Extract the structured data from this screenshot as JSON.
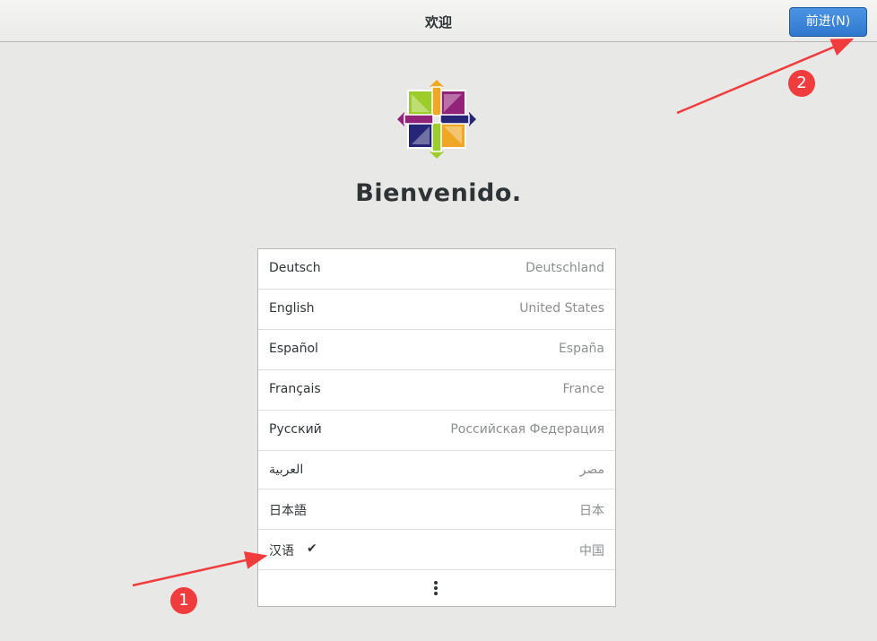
{
  "header": {
    "title": "欢迎",
    "next_label": "前进(N)"
  },
  "welcome_text": "Bienvenido.",
  "languages": [
    {
      "name": "Deutsch",
      "region": "Deutschland"
    },
    {
      "name": "English",
      "region": "United States"
    },
    {
      "name": "Español",
      "region": "España"
    },
    {
      "name": "Français",
      "region": "France"
    },
    {
      "name": "Русский",
      "region": "Российская Федерация"
    },
    {
      "name": "العربية",
      "region": "مصر"
    },
    {
      "name": "日本語",
      "region": "日本"
    },
    {
      "name": "汉语",
      "region": "中国",
      "selected": true
    }
  ],
  "selected_marker": "✔",
  "more_icon": "vertical-ellipsis-icon",
  "annotations": [
    {
      "label": "1"
    },
    {
      "label": "2"
    }
  ],
  "colors": {
    "annotation": "#f03c3c",
    "button": "#3584e4",
    "logo_yellow": "#efa724",
    "logo_green": "#9ccd2a",
    "logo_purple": "#932279",
    "logo_navy": "#262577"
  }
}
